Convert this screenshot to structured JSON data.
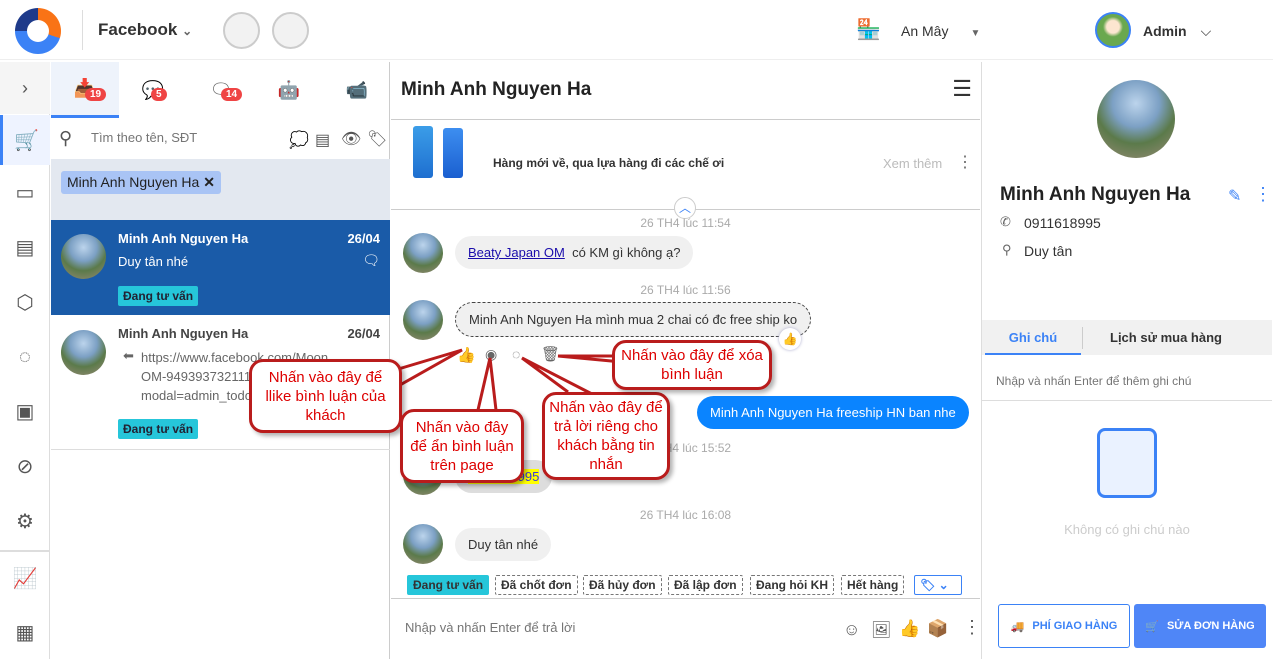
{
  "topbar": {
    "channel": "Facebook",
    "shop": "An Mây",
    "user": "Admin"
  },
  "conv_tabs": [
    {
      "icon": "inbox-icon",
      "badge": "19"
    },
    {
      "icon": "messenger-icon",
      "badge": "5"
    },
    {
      "icon": "comment-icon",
      "badge": "14"
    },
    {
      "icon": "bot-icon"
    },
    {
      "icon": "video-icon"
    }
  ],
  "search": {
    "placeholder": "Tìm theo tên, SĐT"
  },
  "filter_chip": "Minh Anh Nguyen Ha",
  "conversations": [
    {
      "name": "Minh Anh Nguyen Ha",
      "date": "26/04",
      "preview": "Duy tân nhé",
      "tag": "Đang tư vấn"
    },
    {
      "name": "Minh Anh Nguyen Ha",
      "date": "26/04",
      "preview_lines": [
        "https://www.facebook.com/Moon",
        "OM-9493937321118",
        "modal=admin_todo"
      ],
      "tag": "Đang tư vấn"
    }
  ],
  "chat": {
    "title": "Minh Anh Nguyen Ha",
    "post": {
      "text": "Hàng mới về, qua lựa hàng đi các chế ơi",
      "more": "Xem thêm"
    },
    "messages": [
      {
        "time": "26 TH4 lúc 11:54",
        "link": "Beaty Japan OM",
        "text": "có KM gì không ạ?"
      },
      {
        "time": "26 TH4 lúc 11:56",
        "text": "Minh Anh Nguyen Ha mình mua 2 chai có đc free ship ko"
      },
      {
        "outgoing": "Minh Anh Nguyen Ha freeship HN ban nhe"
      },
      {
        "time": "26 TH4 lúc 15:52",
        "highlight": "0911618995"
      },
      {
        "time": "26 TH4 lúc 16:08",
        "text": "Duy tân nhé"
      }
    ],
    "tags": [
      "Đang tư vấn",
      "Đã chốt đơn",
      "Đã hủy đơn",
      "Đã lập đơn",
      "Đang hỏi KH",
      "Hết hàng"
    ],
    "input_placeholder": "Nhập và nhấn Enter để trả lời"
  },
  "callouts": {
    "like": "Nhấn vào đây để llike bình luận của khách",
    "hide": "Nhấn vào đây để ẩn bình luận trên page",
    "reply": "Nhấn vào đây để trả lời riêng cho khách bằng tin nhắn",
    "delete": "Nhấn vào đây để xóa bình luận"
  },
  "customer": {
    "name": "Minh Anh Nguyen Ha",
    "phone": "0911618995",
    "address": "Duy tân"
  },
  "right_tabs": [
    "Ghi chú",
    "Lịch sử mua hàng"
  ],
  "note_placeholder": "Nhập và nhấn Enter để thêm ghi chú",
  "empty_notes": "Không có ghi chú nào",
  "buttons": {
    "shipping": "PHÍ GIAO HÀNG",
    "edit_order": "SỬA ĐƠN HÀNG"
  },
  "colors": {
    "accent": "#3b82f6",
    "selected": "#1a5ba8",
    "tag": "#26c6da",
    "outgoing": "#0a84ff",
    "callout": "#b91c1c"
  }
}
